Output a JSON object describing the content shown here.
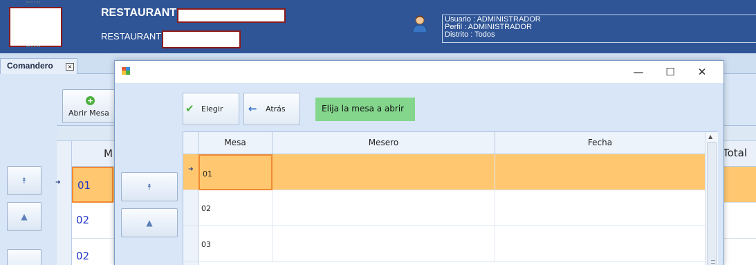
{
  "header": {
    "restaurant_title": "RESTAURANT",
    "restaurant_sub": "RESTAURANT",
    "user_lines": [
      "Usuario : ADMINISTRADOR",
      "Perfil : ADMINISTRADOR",
      "Distrito : Todos"
    ],
    "icons": {
      "user": "user-avatar-icon"
    }
  },
  "tabs": [
    {
      "label": "Comandero",
      "close": "×"
    }
  ],
  "background": {
    "abrir_mesa_label": "Abrir Mesa",
    "column_partial": "M",
    "total_label": "Total",
    "rows": [
      "01",
      "02",
      "02"
    ],
    "selected_marker": "➜"
  },
  "dialog": {
    "title": "",
    "controls": {
      "minimize": "—",
      "maximize": "☐",
      "close": "✕"
    },
    "toolbar": {
      "elegir_label": "Elegir",
      "atras_label": "Atrás",
      "message": "Elija la mesa a abrir"
    },
    "nav": {
      "first": "⯭",
      "prev": "▲"
    },
    "grid": {
      "columns": [
        "Mesa",
        "Mesero",
        "Fecha"
      ],
      "rows": [
        {
          "mesa": "01",
          "mesero": "",
          "fecha": ""
        },
        {
          "mesa": "02",
          "mesero": "",
          "fecha": ""
        },
        {
          "mesa": "03",
          "mesero": "",
          "fecha": ""
        }
      ],
      "selected_marker": "➜"
    }
  },
  "colors": {
    "header_bg": "#2f5597",
    "selected_row": "#ffc870",
    "selected_cell_border": "#f08a32",
    "message_bg": "#84d68c",
    "workspace_bg": "#d8e6f7"
  }
}
